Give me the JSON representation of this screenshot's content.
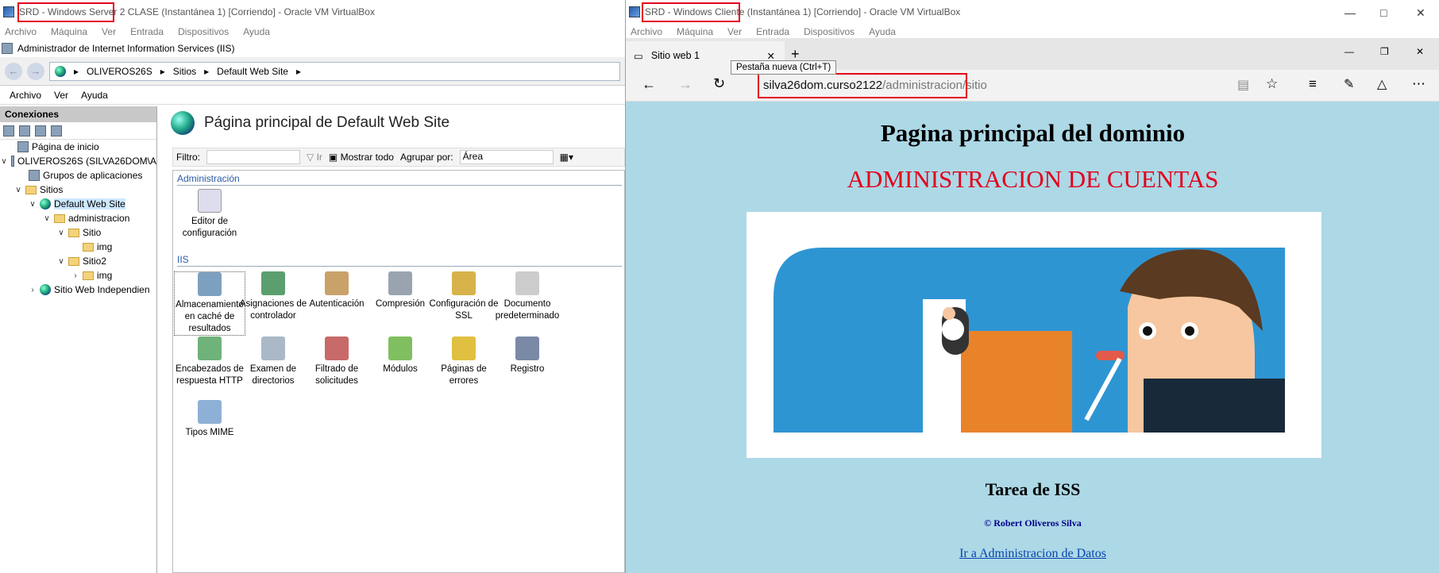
{
  "left_window": {
    "title": "SRD - Windows Server 2 CLASE (Instantánea 1) [Corriendo] - Oracle VM VirtualBox",
    "menu": [
      "Archivo",
      "Máquina",
      "Ver",
      "Entrada",
      "Dispositivos",
      "Ayuda"
    ],
    "iis_title": "Administrador de Internet Information Services (IIS)",
    "breadcrumb": [
      "OLIVEROS26S",
      "Sitios",
      "Default Web Site"
    ],
    "iis_menu": [
      "Archivo",
      "Ver",
      "Ayuda"
    ],
    "connections_label": "Conexiones",
    "tree": [
      "Página de inicio",
      "OLIVEROS26S (SILVA26DOM\\A",
      "Grupos de aplicaciones",
      "Sitios",
      "Default Web Site",
      "administracion",
      "Sitio",
      "img",
      "Sitio2",
      "img",
      "Sitio Web Independien"
    ],
    "main_title": "Página principal de Default Web Site",
    "filter": {
      "label": "Filtro:",
      "go": "Ir",
      "show_all": "Mostrar todo",
      "group_by": "Agrupar por:",
      "group_value": "Área"
    },
    "sections": {
      "admin": "Administración",
      "iis": "IIS"
    },
    "admin_features": [
      "Editor de configuración"
    ],
    "iis_features": [
      "Almacenamiento en caché de resultados",
      "Asignaciones de controlador",
      "Autenticación",
      "Compresión",
      "Configuración de SSL",
      "Documento predeterminado",
      "Encabezados de respuesta HTTP",
      "Examen de directorios",
      "Filtrado de solicitudes",
      "Módulos",
      "Páginas de errores",
      "Registro",
      "Tipos MIME"
    ]
  },
  "right_window": {
    "title": "SRD - Windows Cliente (Instantánea 1) [Corriendo] - Oracle VM VirtualBox",
    "menu": [
      "Archivo",
      "Máquina",
      "Ver",
      "Entrada",
      "Dispositivos",
      "Ayuda"
    ],
    "tab_label": "Sitio web 1",
    "tooltip": "Pestaña nueva (Ctrl+T)",
    "url_host": "silva26dom.curso2122",
    "url_path": "/administracion/sitio",
    "page": {
      "heading": "Pagina principal del dominio",
      "subheading": "ADMINISTRACION DE CUENTAS",
      "task": "Tarea de ISS",
      "copyright": "© Robert Oliveros Silva",
      "link": "Ir a Administracion de Datos"
    }
  }
}
